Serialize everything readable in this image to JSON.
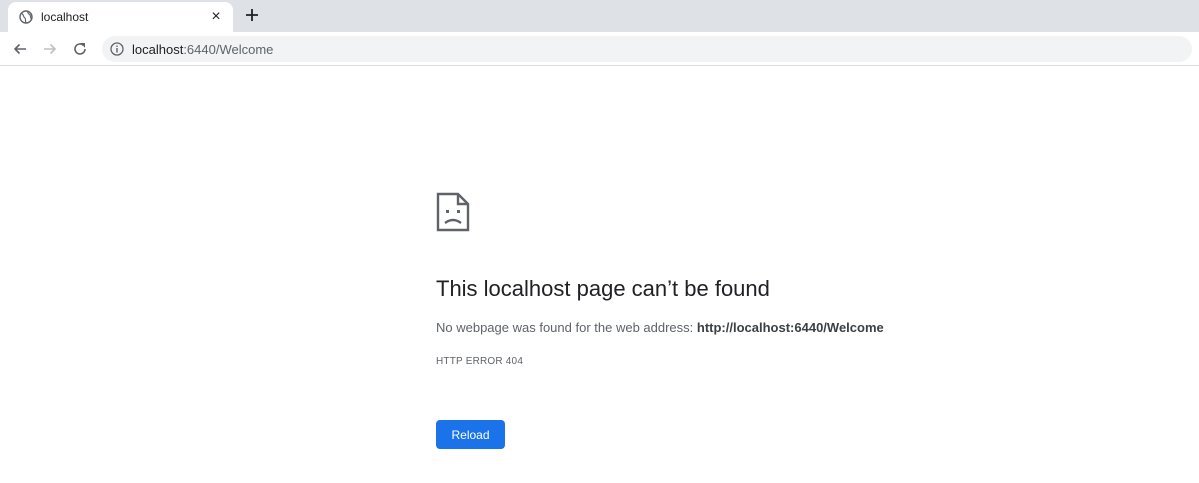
{
  "tab": {
    "title": "localhost",
    "close_symbol": "×",
    "favicon_icon": "globe-icon"
  },
  "toolbar": {
    "back_icon": "arrow-left-icon",
    "forward_icon": "arrow-right-icon",
    "reload_icon": "reload-icon",
    "site_info_icon": "info-icon",
    "url_host": "localhost",
    "url_rest": ":6440/Welcome"
  },
  "error": {
    "icon": "sad-page-icon",
    "title": "This localhost page can’t be found",
    "desc_prefix": "No webpage was found for the web address: ",
    "desc_url": "http://localhost:6440/Welcome",
    "code": "HTTP ERROR 404",
    "reload_label": "Reload"
  },
  "colors": {
    "tab_strip": "#dee1e6",
    "button_blue": "#1a73e8",
    "text_primary": "#202124",
    "text_secondary": "#5f6368"
  }
}
